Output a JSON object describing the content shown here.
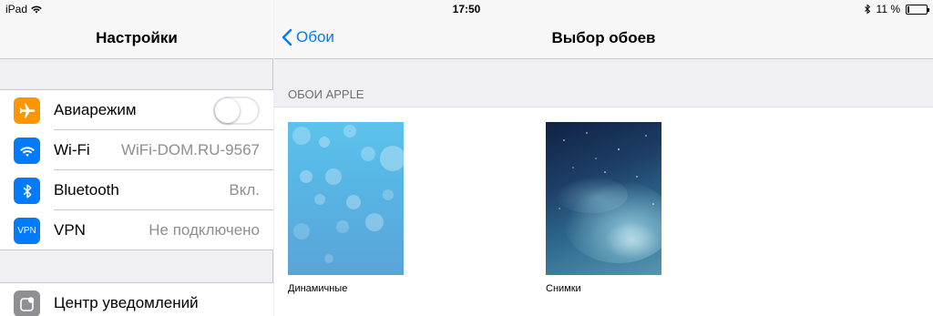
{
  "status_bar": {
    "device": "iPad",
    "time": "17:50",
    "battery_text": "11 %",
    "battery_level": 0.11
  },
  "sidebar": {
    "title": "Настройки",
    "items": [
      {
        "label": "Авиарежим",
        "value": "",
        "icon": "airplane-icon",
        "color": "#ff9500",
        "toggle": false
      },
      {
        "label": "Wi-Fi",
        "value": "WiFi-DOM.RU-9567",
        "icon": "wifi-icon",
        "color": "#007aff"
      },
      {
        "label": "Bluetooth",
        "value": "Вкл.",
        "icon": "bluetooth-icon",
        "color": "#007aff"
      },
      {
        "label": "VPN",
        "value": "Не подключено",
        "icon": "vpn-icon",
        "icon_text": "VPN",
        "color": "#007aff"
      },
      {
        "label": "Центр уведомлений",
        "value": "",
        "icon": "notifications-icon",
        "color": "#8e8e93"
      }
    ]
  },
  "detail": {
    "back_label": "Обои",
    "title": "Выбор обоев",
    "section_header": "ОБОИ APPLE",
    "wallpapers": [
      {
        "caption": "Динамичные"
      },
      {
        "caption": "Снимки"
      }
    ]
  },
  "colors": {
    "accent": "#007aff"
  }
}
